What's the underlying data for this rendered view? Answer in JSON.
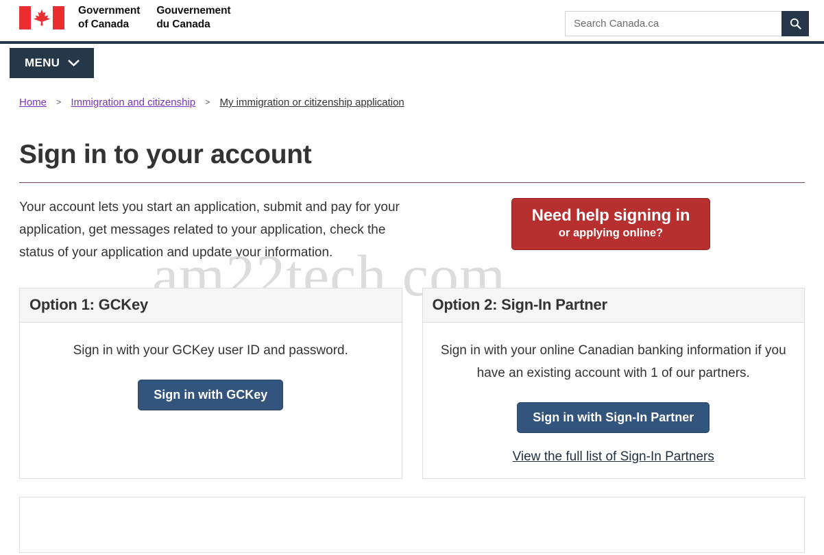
{
  "header": {
    "flag_icon": "canada-flag-icon",
    "wordmark_en": "Government\nof Canada",
    "wordmark_en_line1": "Government",
    "wordmark_en_line2": "of Canada",
    "wordmark_fr_line1": "Gouvernement",
    "wordmark_fr_line2": "du Canada",
    "search": {
      "placeholder": "Search Canada.ca",
      "value": "",
      "button_icon": "search-icon",
      "button_label": "Search"
    }
  },
  "nav": {
    "menu_label": "MENU",
    "menu_icon": "chevron-down-icon"
  },
  "breadcrumb": {
    "items": [
      {
        "label": "Home",
        "current": false
      },
      {
        "label": "Immigration and citizenship",
        "current": false
      },
      {
        "label": "My immigration or citizenship application",
        "current": true
      }
    ],
    "separator": ">"
  },
  "main": {
    "title": "Sign in to your account",
    "intro": "Your account lets you start an application, submit and pay for your application, get messages related to your application, check the status of your application and update your information.",
    "help_button": {
      "line1": "Need help signing in",
      "line2": "or applying online?"
    },
    "watermark": "am22tech.com",
    "options": [
      {
        "heading": "Option 1: GCKey",
        "description": "Sign in with your GCKey user ID and password.",
        "button_label": "Sign in with GCKey",
        "link_label": ""
      },
      {
        "heading": "Option 2: Sign-In Partner",
        "description": "Sign in with your online Canadian banking information if you have an existing account with 1 of our partners.",
        "button_label": "Sign in with Sign-In Partner",
        "link_label": "View the full list of Sign-In Partners"
      }
    ]
  },
  "colors": {
    "header_navy": "#26374a",
    "button_navy": "#33547d",
    "help_red": "#b7302f",
    "link_purple": "#7834bc",
    "title_rule": "#74404a",
    "flag_red": "#ea2d2e",
    "panel_head_bg": "#f5f5f5",
    "panel_border": "#dedede",
    "watermark_gray": "#d6d6d6"
  }
}
